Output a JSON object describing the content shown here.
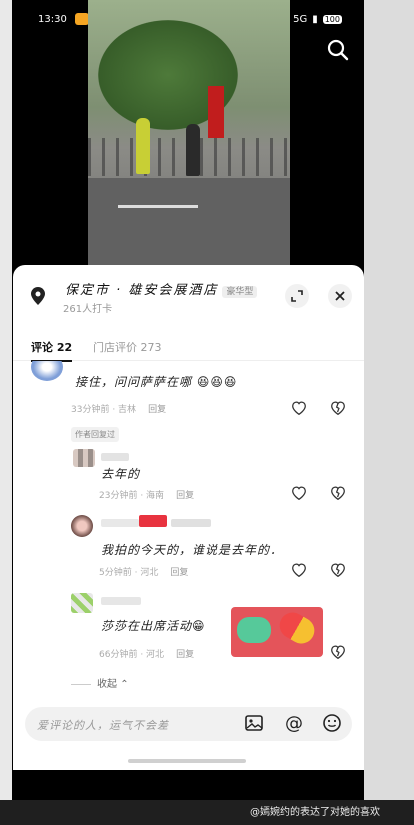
{
  "status_bar": {
    "time": "13:30",
    "app_colors": [
      "#f5a623",
      "#3b82f6",
      "#1f6fe0",
      "#e34b4b",
      "#e85aa0"
    ],
    "signal": "5G",
    "battery": "100"
  },
  "header": {
    "place": "保定市 · 雄安会展酒店",
    "place_tag": "豪华型",
    "checkins": "261人打卡"
  },
  "tabs": [
    {
      "label": "评论 22"
    },
    {
      "label": "门店评价 273"
    }
  ],
  "comments": [
    {
      "text": "接住，问问萨萨在哪",
      "emojis": "😆😆😆",
      "time": "33分钟前",
      "location": "吉林",
      "reply": "回复"
    },
    {
      "author_tag": "作者回复过",
      "text": "去年的",
      "time": "23分钟前",
      "location": "海南",
      "reply": "回复"
    },
    {
      "text": "我拍的今天的，谁说是去年的．",
      "time": "5分钟前",
      "location": "河北",
      "reply": "回复"
    },
    {
      "text": "莎莎在出席活动",
      "emojis": "😁",
      "time": "66分钟前",
      "location": "河北",
      "reply": "回复"
    }
  ],
  "collapse_label": "收起",
  "input": {
    "placeholder": "爱评论的人，运气不会差"
  },
  "watermark": "@嫣婉约的表达了对她的喜欢",
  "colors": {
    "accent": "#e4545a",
    "sheet_bg": "#ffffff"
  }
}
